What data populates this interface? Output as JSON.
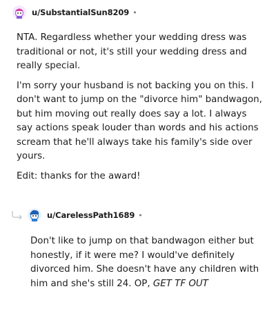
{
  "comments": [
    {
      "username": "u/SubstantialSun8209",
      "separator": "•",
      "paragraphs": [
        "NTA. Regardless whether your wedding dress was traditional or not, it's still your wedding dress and really special.",
        "I'm sorry your husband is not backing you on this. I don't want to jump on the \"divorce him\" bandwagon, but him moving out really does say a lot. I always say actions speak louder than words and his actions scream that he'll always take his family's side over yours.",
        "Edit: thanks for the award!"
      ]
    },
    {
      "username": "u/CarelessPath1689",
      "separator": "•",
      "text_main": "Don't like to jump on that bandwagon either but honestly, if it were me? I would've definitely divorced him. She doesn't have any children with him and she's still 24. OP, ",
      "text_emphasis": "GET TF OUT"
    }
  ],
  "colors": {
    "text": "#1c1c1c",
    "meta": "#7c7c7c",
    "thread_line": "#edeff1"
  },
  "icons": {
    "avatar1": "snoo-avatar-purple",
    "avatar2": "snoo-avatar-blue",
    "reply": "reply-arrow-icon"
  }
}
